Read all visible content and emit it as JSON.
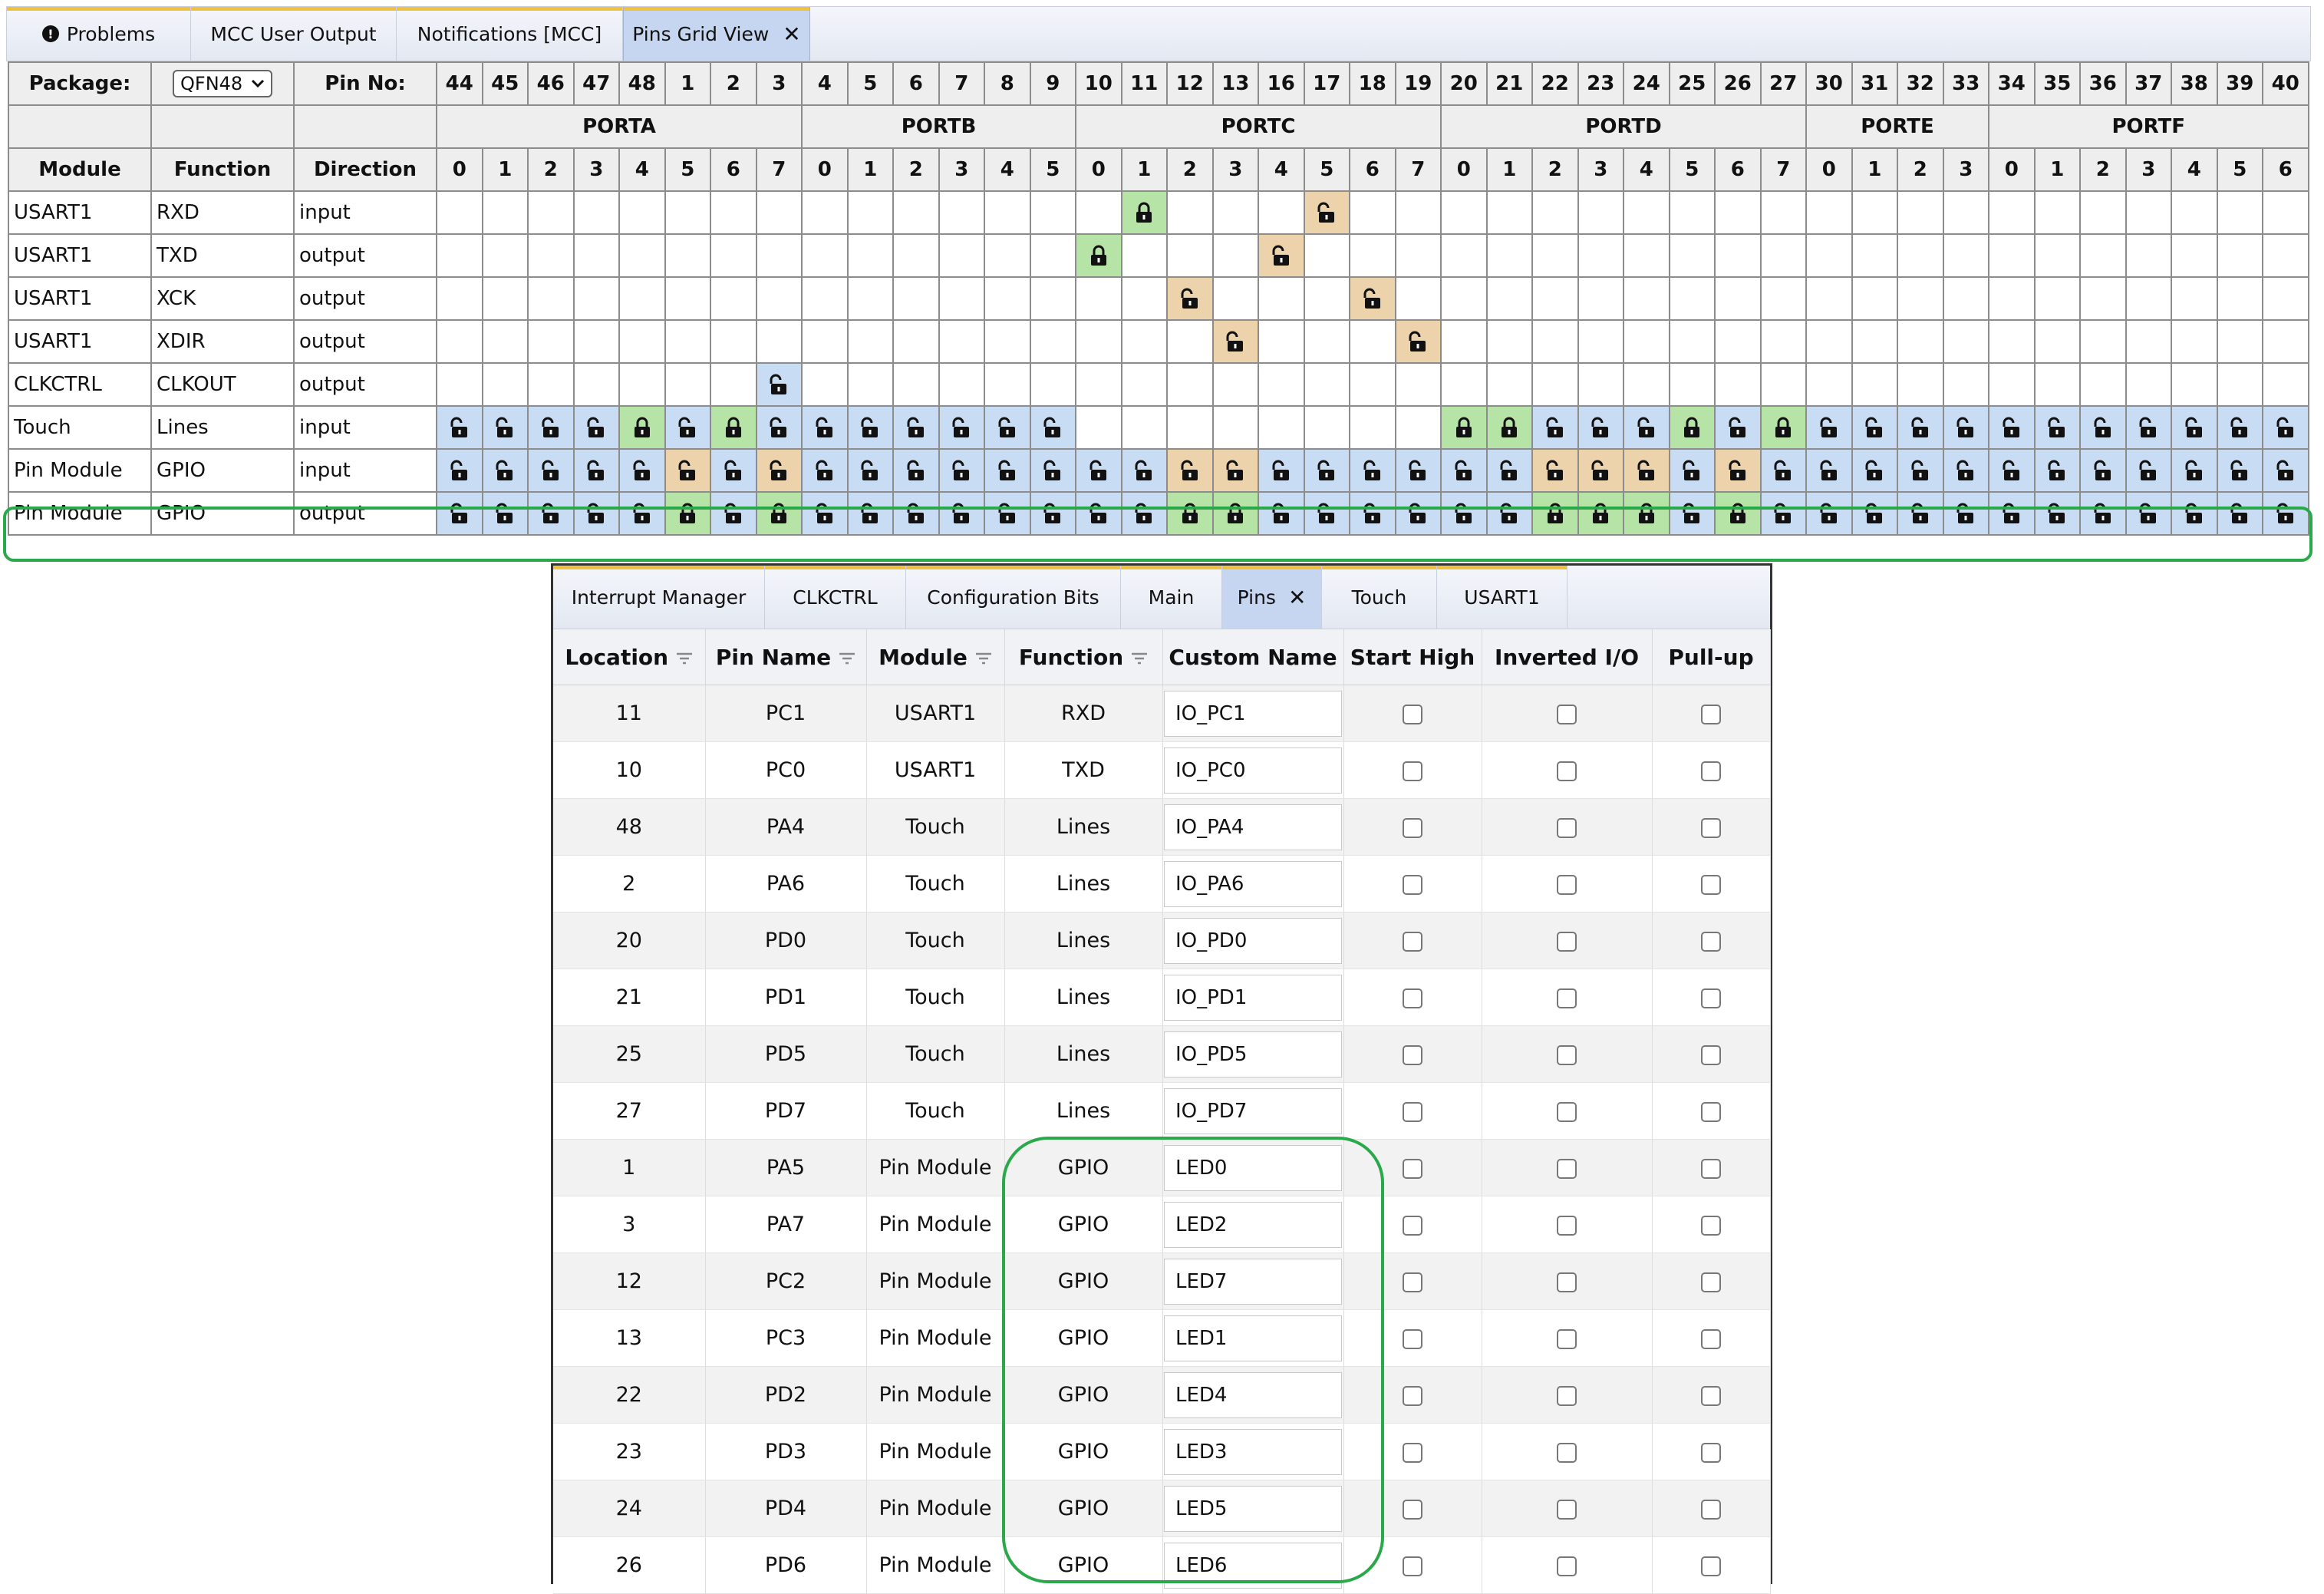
{
  "top_tabs": [
    {
      "label": "Problems",
      "icon": "problems-icon"
    },
    {
      "label": "MCC User Output"
    },
    {
      "label": "Notifications [MCC]"
    },
    {
      "label": "Pins Grid View",
      "active": true,
      "close": "✕"
    }
  ],
  "grid": {
    "package_label": "Package:",
    "package_value": "QFN48",
    "pin_no_label": "Pin No:",
    "pin_numbers": [
      "44",
      "45",
      "46",
      "47",
      "48",
      "1",
      "2",
      "3",
      "4",
      "5",
      "6",
      "7",
      "8",
      "9",
      "10",
      "11",
      "12",
      "13",
      "16",
      "17",
      "18",
      "19",
      "20",
      "21",
      "22",
      "23",
      "24",
      "25",
      "26",
      "27",
      "30",
      "31",
      "32",
      "33",
      "34",
      "35",
      "36",
      "37",
      "38",
      "39",
      "40"
    ],
    "ports": [
      {
        "name": "PORTA",
        "span": 8
      },
      {
        "name": "PORTB",
        "span": 6
      },
      {
        "name": "PORTC",
        "span": 8
      },
      {
        "name": "PORTD",
        "span": 8
      },
      {
        "name": "PORTE",
        "span": 4
      },
      {
        "name": "PORTF",
        "span": 7
      }
    ],
    "headers": {
      "module": "Module",
      "function": "Function",
      "direction": "Direction"
    },
    "bit_numbers": [
      "0",
      "1",
      "2",
      "3",
      "4",
      "5",
      "6",
      "7",
      "0",
      "1",
      "2",
      "3",
      "4",
      "5",
      "0",
      "1",
      "2",
      "3",
      "4",
      "5",
      "6",
      "7",
      "0",
      "1",
      "2",
      "3",
      "4",
      "5",
      "6",
      "7",
      "0",
      "1",
      "2",
      "3",
      "0",
      "1",
      "2",
      "3",
      "4",
      "5",
      "6"
    ],
    "colors": {
      "available": "#c8ddf4",
      "selected": "#b6e3a6",
      "alternate": "#ecd3ac",
      "highlight": "#2aa94a"
    },
    "rows": [
      {
        "module": "USART1",
        "function": "RXD",
        "direction": "input",
        "cells": "...............G...T........................."
      },
      {
        "module": "USART1",
        "function": "TXD",
        "direction": "output",
        "cells": "..............G...T.........................."
      },
      {
        "module": "USART1",
        "function": "XCK",
        "direction": "output",
        "cells": "................T...T........................"
      },
      {
        "module": "USART1",
        "function": "XDIR",
        "direction": "output",
        "cells": ".................T...T......................."
      },
      {
        "module": "CLKCTRL",
        "function": "CLKOUT",
        "direction": "output",
        "cells": ".......B................................."
      },
      {
        "module": "Touch",
        "function": "Lines",
        "direction": "input",
        "cells": "BBBBGBGBBBBBBB........GGBBBGBGBBBBBBBBBBB"
      },
      {
        "module": "Pin Module",
        "function": "GPIO",
        "direction": "input",
        "cells": "BBBBBTBTBBBBBBBBTTBBBBBBTTTBTBBBBBBBBBBBB"
      },
      {
        "module": "Pin Module",
        "function": "GPIO",
        "direction": "output",
        "cells": "BBBBBGBGBBBBBBBBGGBBBBBBGGGBGBBBBBBBBBBBB"
      }
    ]
  },
  "bottom_tabs": [
    {
      "label": "Interrupt Manager"
    },
    {
      "label": "CLKCTRL"
    },
    {
      "label": "Configuration Bits"
    },
    {
      "label": "Main"
    },
    {
      "label": "Pins",
      "active": true,
      "close": "✕"
    },
    {
      "label": "Touch"
    },
    {
      "label": "USART1"
    }
  ],
  "pins_table": {
    "columns": [
      "Location",
      "Pin Name",
      "Module",
      "Function",
      "Custom Name",
      "Start High",
      "Inverted I/O",
      "Pull-up"
    ],
    "rows": [
      {
        "location": "11",
        "pin": "PC1",
        "module": "USART1",
        "function": "RXD",
        "custom": "IO_PC1"
      },
      {
        "location": "10",
        "pin": "PC0",
        "module": "USART1",
        "function": "TXD",
        "custom": "IO_PC0"
      },
      {
        "location": "48",
        "pin": "PA4",
        "module": "Touch",
        "function": "Lines",
        "custom": "IO_PA4"
      },
      {
        "location": "2",
        "pin": "PA6",
        "module": "Touch",
        "function": "Lines",
        "custom": "IO_PA6"
      },
      {
        "location": "20",
        "pin": "PD0",
        "module": "Touch",
        "function": "Lines",
        "custom": "IO_PD0"
      },
      {
        "location": "21",
        "pin": "PD1",
        "module": "Touch",
        "function": "Lines",
        "custom": "IO_PD1"
      },
      {
        "location": "25",
        "pin": "PD5",
        "module": "Touch",
        "function": "Lines",
        "custom": "IO_PD5"
      },
      {
        "location": "27",
        "pin": "PD7",
        "module": "Touch",
        "function": "Lines",
        "custom": "IO_PD7"
      },
      {
        "location": "1",
        "pin": "PA5",
        "module": "Pin Module",
        "function": "GPIO",
        "custom": "LED0"
      },
      {
        "location": "3",
        "pin": "PA7",
        "module": "Pin Module",
        "function": "GPIO",
        "custom": "LED2"
      },
      {
        "location": "12",
        "pin": "PC2",
        "module": "Pin Module",
        "function": "GPIO",
        "custom": "LED7"
      },
      {
        "location": "13",
        "pin": "PC3",
        "module": "Pin Module",
        "function": "GPIO",
        "custom": "LED1"
      },
      {
        "location": "22",
        "pin": "PD2",
        "module": "Pin Module",
        "function": "GPIO",
        "custom": "LED4"
      },
      {
        "location": "23",
        "pin": "PD3",
        "module": "Pin Module",
        "function": "GPIO",
        "custom": "LED3"
      },
      {
        "location": "24",
        "pin": "PD4",
        "module": "Pin Module",
        "function": "GPIO",
        "custom": "LED5"
      },
      {
        "location": "26",
        "pin": "PD6",
        "module": "Pin Module",
        "function": "GPIO",
        "custom": "LED6"
      }
    ]
  }
}
